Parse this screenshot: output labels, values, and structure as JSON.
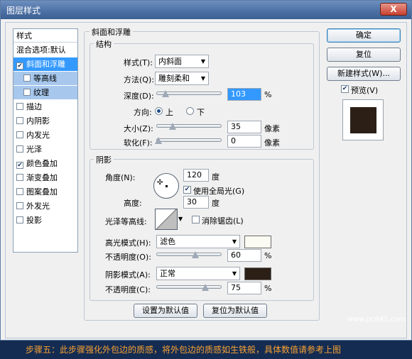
{
  "window": {
    "title": "图层样式",
    "close": "X"
  },
  "stylelist": {
    "header": "样式",
    "items": [
      {
        "label": "混合选项:默认",
        "checked": null
      },
      {
        "label": "斜面和浮雕",
        "checked": true
      },
      {
        "label": "等高线",
        "checked": false
      },
      {
        "label": "纹理",
        "checked": false
      },
      {
        "label": "描边",
        "checked": false
      },
      {
        "label": "内阴影",
        "checked": false
      },
      {
        "label": "内发光",
        "checked": false
      },
      {
        "label": "光泽",
        "checked": false
      },
      {
        "label": "颜色叠加",
        "checked": true
      },
      {
        "label": "渐变叠加",
        "checked": false
      },
      {
        "label": "图案叠加",
        "checked": false
      },
      {
        "label": "外发光",
        "checked": false
      },
      {
        "label": "投影",
        "checked": false
      }
    ]
  },
  "bevel": {
    "title": "斜面和浮雕",
    "structure": {
      "title": "结构",
      "style_label": "样式(T):",
      "style_value": "内斜面",
      "method_label": "方法(Q):",
      "method_value": "雕刻柔和",
      "depth_label": "深度(D):",
      "depth_value": "103",
      "depth_unit": "%",
      "direction_label": "方向:",
      "dir_up": "上",
      "dir_down": "下",
      "size_label": "大小(Z):",
      "size_value": "35",
      "size_unit": "像素",
      "soften_label": "软化(F):",
      "soften_value": "0",
      "soften_unit": "像素"
    },
    "shading": {
      "title": "阴影",
      "angle_label": "角度(N):",
      "angle_value": "120",
      "angle_unit": "度",
      "global_light": "使用全局光(G)",
      "altitude_label": "高度:",
      "altitude_value": "30",
      "altitude_unit": "度",
      "gloss_label": "光泽等高线:",
      "anti_alias": "消除锯齿(L)",
      "highlight_mode_label": "高光模式(H):",
      "highlight_mode_value": "滤色",
      "highlight_color": "#fbfbf3",
      "highlight_opacity_label": "不透明度(O):",
      "highlight_opacity_value": "60",
      "pct": "%",
      "shadow_mode_label": "阴影模式(A):",
      "shadow_mode_value": "正常",
      "shadow_color": "#2c1f16",
      "shadow_opacity_label": "不透明度(C):",
      "shadow_opacity_value": "75"
    },
    "set_default": "设置为默认值",
    "reset_default": "复位为默认值"
  },
  "right": {
    "ok": "确定",
    "reset": "复位",
    "new_style": "新建样式(W)...",
    "preview": "预览(V)"
  },
  "watermark": "www.pc841.com",
  "caption": "步骤五：此步骤强化外包边的质感，将外包边的质感如生铁般，具体数值请参考上图"
}
